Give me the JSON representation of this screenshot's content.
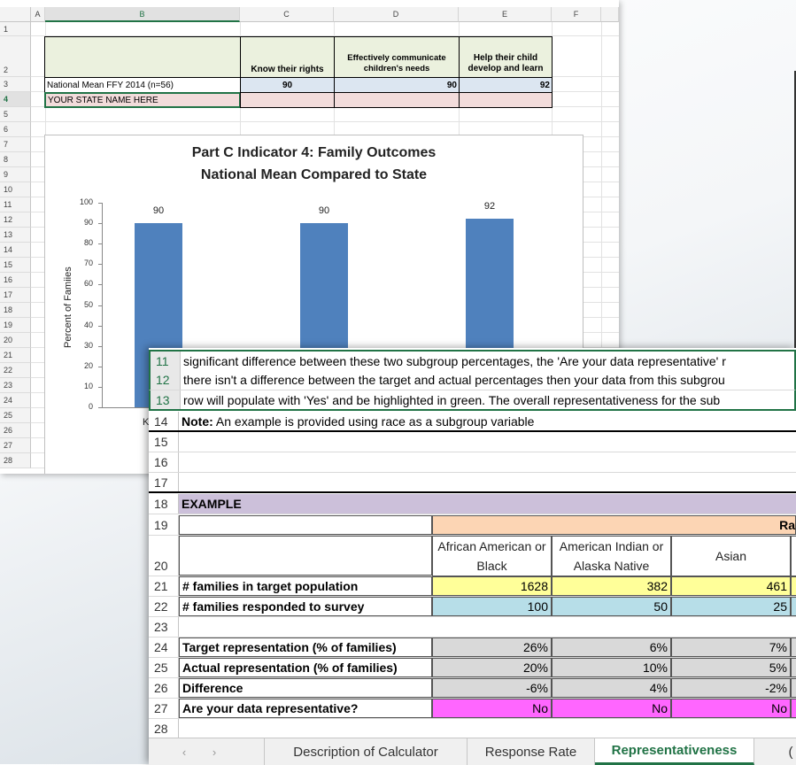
{
  "back_sheet": {
    "columns": [
      "A",
      "B",
      "C",
      "D",
      "E",
      "F"
    ],
    "rows": [
      "1",
      "2",
      "3",
      "4",
      "5",
      "6",
      "7",
      "8",
      "9",
      "10",
      "11",
      "12",
      "13",
      "14",
      "15",
      "16",
      "17",
      "18",
      "19",
      "20",
      "21",
      "22",
      "23",
      "24",
      "25",
      "26",
      "27",
      "28"
    ],
    "table": {
      "headers": [
        "",
        "Know their rights",
        "Effectively communicate children's needs",
        "Help their child develop and learn"
      ],
      "row3": {
        "label": "National Mean FFY 2014 (n=56)",
        "values": [
          "90",
          "90",
          "92"
        ]
      },
      "row4": {
        "label": "YOUR STATE NAME HERE",
        "values": [
          "",
          "",
          ""
        ]
      }
    }
  },
  "chart_data": {
    "type": "bar",
    "title": "Part C Indicator 4: Family Outcomes",
    "subtitle": "National Mean Compared to State",
    "ylabel": "Percent of Famiies",
    "ylim": [
      0,
      100
    ],
    "yticks": [
      "100",
      "90",
      "80",
      "70",
      "60",
      "50",
      "40",
      "30",
      "20",
      "10",
      "0"
    ],
    "categories": [
      "Know their rights",
      "Effectively communicate children's needs",
      "Help their child develop and learn"
    ],
    "values": [
      90,
      90,
      92
    ],
    "value_labels": [
      "90",
      "90",
      "92"
    ],
    "first_category_fragment": "K",
    "color": "#4f81bd"
  },
  "front_sheet": {
    "rows": {
      "r11": {
        "num": "11",
        "text": "significant difference between these two subgroup percentages, the 'Are your data representative' r"
      },
      "r12": {
        "num": "12",
        "text": "there isn't a  difference between the target and actual percentages then your data from this subgrou"
      },
      "r13": {
        "num": "13",
        "text": "row will populate with 'Yes' and be highlighted in green. The overall representativeness for the sub"
      },
      "r14": {
        "num": "14",
        "note_label": "Note:",
        "text": " An example is provided using race as a subgroup variable"
      },
      "r15": {
        "num": "15"
      },
      "r16": {
        "num": "16"
      },
      "r17": {
        "num": "17"
      },
      "r18": {
        "num": "18",
        "text": "EXAMPLE"
      },
      "r19": {
        "num": "19",
        "partial_header": "Ra"
      },
      "r20": {
        "num": "20"
      },
      "r23": {
        "num": "23"
      },
      "r28": {
        "num": "28"
      }
    },
    "race_headers": [
      "African American or Black",
      "American Indian or Alaska Native",
      "Asian"
    ],
    "data_rows": [
      {
        "num": "21",
        "label": "# families in target population",
        "values": [
          "1628",
          "382",
          "461"
        ],
        "color": "#ffff99"
      },
      {
        "num": "22",
        "label": "# families responded to survey",
        "values": [
          "100",
          "50",
          "25"
        ],
        "color": "#b7dee8"
      },
      {
        "num": "24",
        "label": "Target representation (% of families)",
        "values": [
          "26%",
          "6%",
          "7%"
        ],
        "color": "#d9d9d9"
      },
      {
        "num": "25",
        "label": "Actual representation (% of families)",
        "values": [
          "20%",
          "10%",
          "5%"
        ],
        "color": "#d9d9d9"
      },
      {
        "num": "26",
        "label": "Difference",
        "values": [
          "-6%",
          "4%",
          "-2%"
        ],
        "color": "#d9d9d9"
      },
      {
        "num": "27",
        "label": "Are your data representative?",
        "values": [
          "No",
          "No",
          "No"
        ],
        "color": "#ff66ff"
      }
    ],
    "colors": {
      "example_band": "#ccc0da",
      "race_band": "#fcd5b4",
      "green_accent": "#217346"
    }
  },
  "tabs": {
    "prev_icon": "‹",
    "next_icon": "›",
    "items": [
      "Description of Calculator",
      "Response Rate",
      "Representativeness",
      "("
    ],
    "active": "Representativeness"
  }
}
